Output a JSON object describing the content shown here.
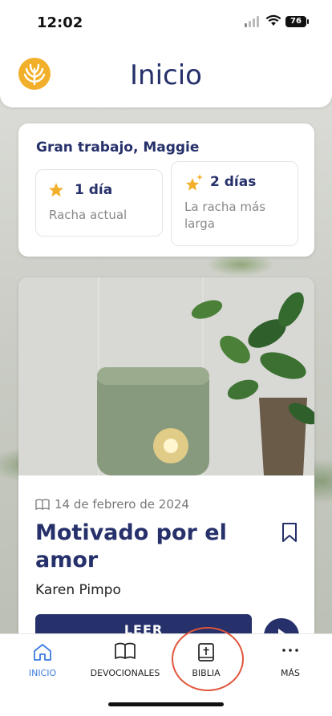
{
  "status_bar": {
    "time": "12:02",
    "battery": "76"
  },
  "header": {
    "title": "Inicio"
  },
  "streaks": {
    "greeting": "Gran trabajo, Maggie",
    "current": {
      "value": "1 día",
      "label": "Racha actual"
    },
    "longest": {
      "value": "2 días",
      "label": "La racha más larga"
    }
  },
  "devotional": {
    "date": "14 de febrero de 2024",
    "title": "Motivado por el amor",
    "author": "Karen Pimpo",
    "read_label": "LEER"
  },
  "tabs": [
    {
      "label": "INICIO",
      "icon": "home-icon",
      "active": true
    },
    {
      "label": "DEVOCIONALES",
      "icon": "open-book-icon",
      "active": false
    },
    {
      "label": "BIBLIA",
      "icon": "bible-icon",
      "active": false
    },
    {
      "label": "MÁS",
      "icon": "more-dots-icon",
      "active": false
    }
  ],
  "colors": {
    "primary": "#26306a",
    "accent": "#3b7be0",
    "logo": "#f2b02a",
    "highlight": "#e0553a"
  }
}
